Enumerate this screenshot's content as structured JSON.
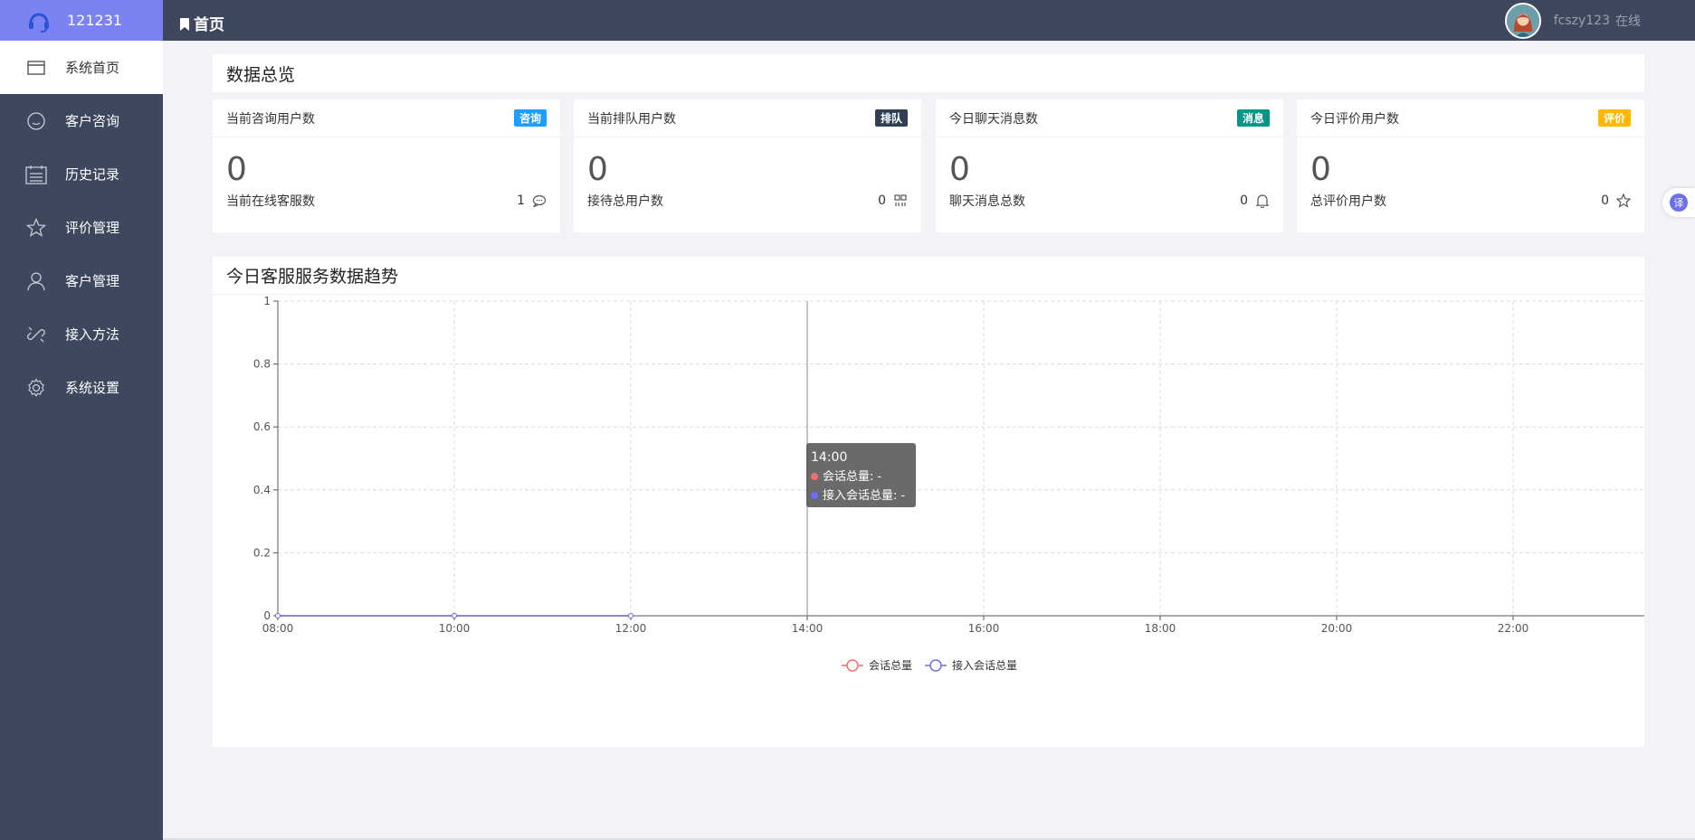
{
  "brand": {
    "name": "121231"
  },
  "sidebar": {
    "items": [
      {
        "label": "系统首页",
        "icon": "window-icon",
        "active": true
      },
      {
        "label": "客户咨询",
        "icon": "smile-icon"
      },
      {
        "label": "历史记录",
        "icon": "calendar-list-icon"
      },
      {
        "label": "评价管理",
        "icon": "star-icon"
      },
      {
        "label": "客户管理",
        "icon": "user-icon"
      },
      {
        "label": "接入方法",
        "icon": "link-icon"
      },
      {
        "label": "系统设置",
        "icon": "gear-icon"
      }
    ]
  },
  "topbar": {
    "breadcrumb": "首页",
    "username": "fcszy123",
    "status": "在线"
  },
  "overview": {
    "title": "数据总览"
  },
  "stats": [
    {
      "title": "当前咨询用户数",
      "badge": "咨询",
      "badge_color": "#1e9fff",
      "value": "0",
      "sub_label": "当前在线客服数",
      "sub_value": "1",
      "icon": "chat-icon"
    },
    {
      "title": "当前排队用户数",
      "badge": "排队",
      "badge_color": "#2f4056",
      "value": "0",
      "sub_label": "接待总用户数",
      "sub_value": "0",
      "icon": "grid-icon"
    },
    {
      "title": "今日聊天消息数",
      "badge": "消息",
      "badge_color": "#009688",
      "value": "0",
      "sub_label": "聊天消息总数",
      "sub_value": "0",
      "icon": "bell-icon"
    },
    {
      "title": "今日评价用户数",
      "badge": "评价",
      "badge_color": "#ffb800",
      "value": "0",
      "sub_label": "总评价用户数",
      "sub_value": "0",
      "icon": "star-outline-icon"
    }
  ],
  "trend": {
    "title": "今日客服服务数据趋势"
  },
  "chart_data": {
    "type": "line",
    "title": "",
    "x": [
      "08:00",
      "10:00",
      "12:00",
      "14:00",
      "16:00",
      "18:00",
      "20:00",
      "22:00"
    ],
    "ylim": [
      0,
      1
    ],
    "yticks": [
      "0",
      "0.2",
      "0.4",
      "0.6",
      "0.8",
      "1"
    ],
    "grid": true,
    "legend_position": "bottom-center",
    "series": [
      {
        "name": "会话总量",
        "color": "#f56c6c",
        "values": [
          0,
          0,
          0,
          null,
          null,
          null,
          null,
          null
        ]
      },
      {
        "name": "接入会话总量",
        "color": "#6b6ff0",
        "values": [
          0,
          0,
          0,
          null,
          null,
          null,
          null,
          null
        ]
      }
    ],
    "tooltip": {
      "title": "14:00",
      "items": [
        {
          "label": "会话总量: -",
          "color": "#f56c6c"
        },
        {
          "label": "接入会话总量: -",
          "color": "#6b6ff0"
        }
      ]
    }
  },
  "translate": {
    "label": "译"
  }
}
